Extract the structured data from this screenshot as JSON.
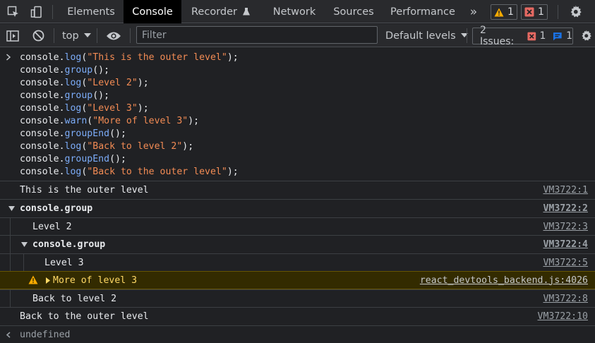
{
  "tabs": {
    "elements": "Elements",
    "console": "Console",
    "recorder": "Recorder",
    "network": "Network",
    "sources": "Sources",
    "performance": "Performance",
    "more": "»"
  },
  "counts": {
    "warnings": "1",
    "errors": "1"
  },
  "toolbar": {
    "context": "top",
    "filter_placeholder": "Filter",
    "levels": "Default levels",
    "issues_label": "2 Issues:",
    "issues_errors": "1",
    "issues_info": "1"
  },
  "code": {
    "l1": [
      "console.",
      "log",
      "(",
      "\"This is the outer level\"",
      ");"
    ],
    "l2": [
      "console.",
      "group",
      "();"
    ],
    "l3": [
      "console.",
      "log",
      "(",
      "\"Level 2\"",
      ");"
    ],
    "l4": [
      "console.",
      "group",
      "();"
    ],
    "l5": [
      "console.",
      "log",
      "(",
      "\"Level 3\"",
      ");"
    ],
    "l6": [
      "console.",
      "warn",
      "(",
      "\"More of level 3\"",
      ");"
    ],
    "l7": [
      "console.",
      "groupEnd",
      "();"
    ],
    "l8": [
      "console.",
      "log",
      "(",
      "\"Back to level 2\"",
      ");"
    ],
    "l9": [
      "console.",
      "groupEnd",
      "();"
    ],
    "l10": [
      "console.",
      "log",
      "(",
      "\"Back to the outer level\"",
      ");"
    ]
  },
  "output": [
    {
      "text": "This is the outer level",
      "source": "VM3722:1"
    },
    {
      "text": "console.group",
      "source": "VM3722:2"
    },
    {
      "text": "Level 2",
      "source": "VM3722:3"
    },
    {
      "text": "console.group",
      "source": "VM3722:4"
    },
    {
      "text": "Level 3",
      "source": "VM3722:5"
    },
    {
      "text": "More of level 3",
      "source": "react_devtools_backend.js:4026"
    },
    {
      "text": "Back to level 2",
      "source": "VM3722:8"
    },
    {
      "text": "Back to the outer level",
      "source": "VM3722:10"
    }
  ],
  "result": "undefined",
  "colors": {
    "method": "#7cacf8",
    "string": "#f28b54",
    "warning": "#ffd965",
    "error": "#e46962"
  }
}
